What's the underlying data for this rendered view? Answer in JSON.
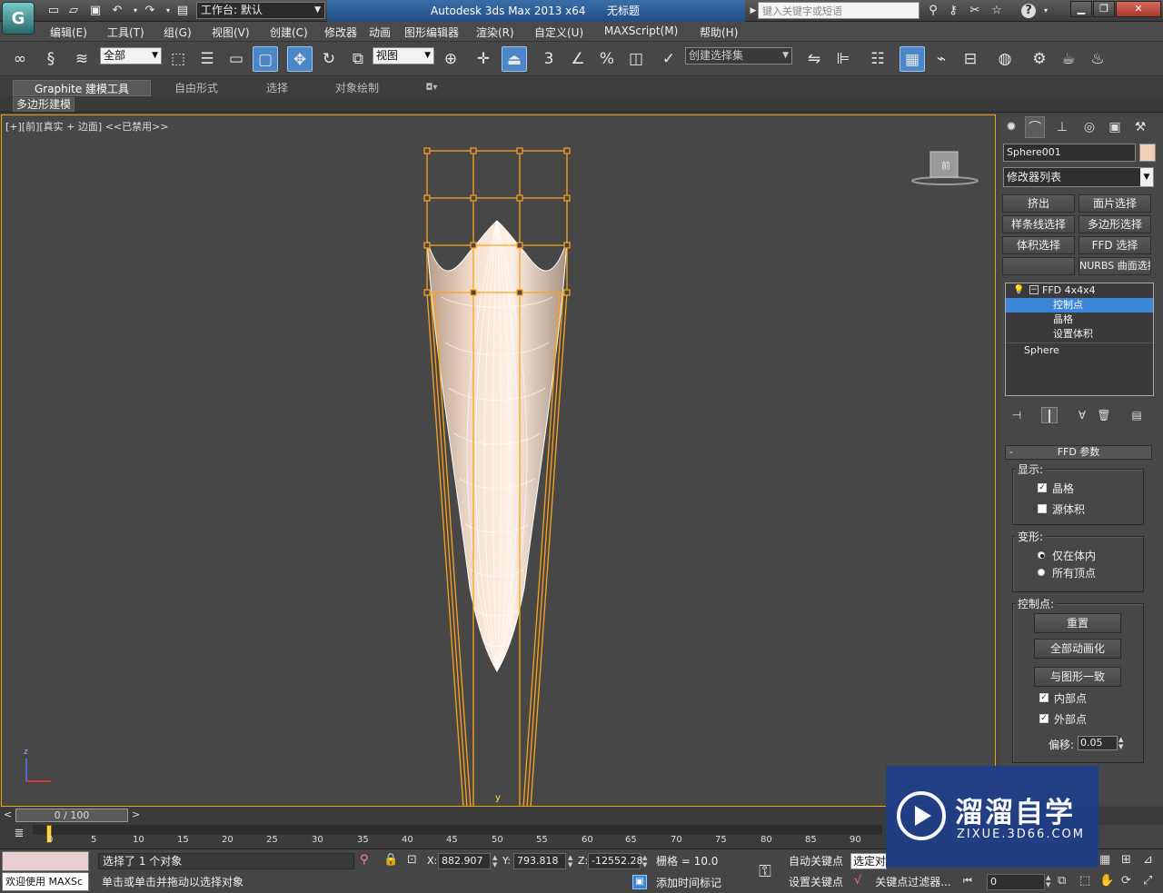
{
  "app": {
    "logo": "G",
    "title": "Autodesk 3ds Max  2013 x64",
    "file": "无标题",
    "workspace": "工作台: 默认",
    "search_placeholder": "键入关键字或短语"
  },
  "menu": [
    "编辑(E)",
    "工具(T)",
    "组(G)",
    "视图(V)",
    "创建(C)",
    "修改器",
    "动画",
    "图形编辑器",
    "渲染(R)",
    "自定义(U)",
    "MAXScript(M)",
    "帮助(H)"
  ],
  "toolbar": {
    "filter": "全部",
    "refcoord": "视图",
    "snap3": "3",
    "named_sel": "创建选择集"
  },
  "ribbon": {
    "tabs": [
      "Graphite 建模工具",
      "自由形式",
      "选择",
      "对象绘制"
    ],
    "sub": "多边形建模"
  },
  "viewport": {
    "label": "[+][前][真实 + 边面] <<已禁用>>",
    "axis_y": "y",
    "axis_z": "z",
    "viewcube": "前"
  },
  "cmd": {
    "tabs": [
      "sun-icon",
      "curve-icon",
      "hierarchy-icon",
      "motion-icon",
      "display-icon",
      "utility-icon"
    ],
    "obj_name": "Sphere001",
    "obj_color": "#f2d0b8",
    "modlist": "修改器列表",
    "mod_buttons": [
      "挤出",
      "面片选择",
      "样条线选择",
      "多边形选择",
      "体积选择",
      "FFD 选择",
      "",
      "NURBS 曲面选择"
    ],
    "stack": [
      {
        "label": "FFD 4x4x4",
        "level": 0
      },
      {
        "label": "控制点",
        "level": 1,
        "selected": true
      },
      {
        "label": "晶格",
        "level": 1
      },
      {
        "label": "设置体积",
        "level": 1
      },
      {
        "label": "Sphere",
        "level": 0
      }
    ],
    "rollout": "FFD 参数",
    "display_group": "显示:",
    "lattice": "晶格",
    "source_volume": "源体积",
    "deform_group": "变形:",
    "only_in_volume": "仅在体内",
    "all_vertices": "所有顶点",
    "cp_group": "控制点:",
    "reset": "重置",
    "animate_all": "全部动画化",
    "conform": "与图形一致",
    "inside": "内部点",
    "outside": "外部点",
    "offset_label": "偏移:",
    "offset": "0.05"
  },
  "timeline": {
    "frame": "0 / 100",
    "ticks": [
      "0",
      "5",
      "10",
      "15",
      "20",
      "25",
      "30",
      "35",
      "40",
      "45",
      "50",
      "55",
      "60",
      "65",
      "70",
      "75",
      "80",
      "85",
      "90"
    ]
  },
  "status": {
    "welcome": "欢迎使用 MAXSc",
    "selected": "选择了 1 个对象",
    "prompt": "单击或单击并拖动以选择对象",
    "x_label": "X:",
    "x": "882.907",
    "y_label": "Y:",
    "y": "793.818",
    "z_label": "Z:",
    "z": "-12552.28",
    "grid": "栅格 = 10.0",
    "add_time_tag": "添加时间标记",
    "auto_key": "自动关键点",
    "selected_dd": "选定对",
    "set_key": "设置关键点",
    "key_filter": "关键点过滤器...",
    "frame": "0"
  },
  "watermark": {
    "brand": "溜溜自学",
    "url": "ZIXUE.3D66.COM"
  }
}
